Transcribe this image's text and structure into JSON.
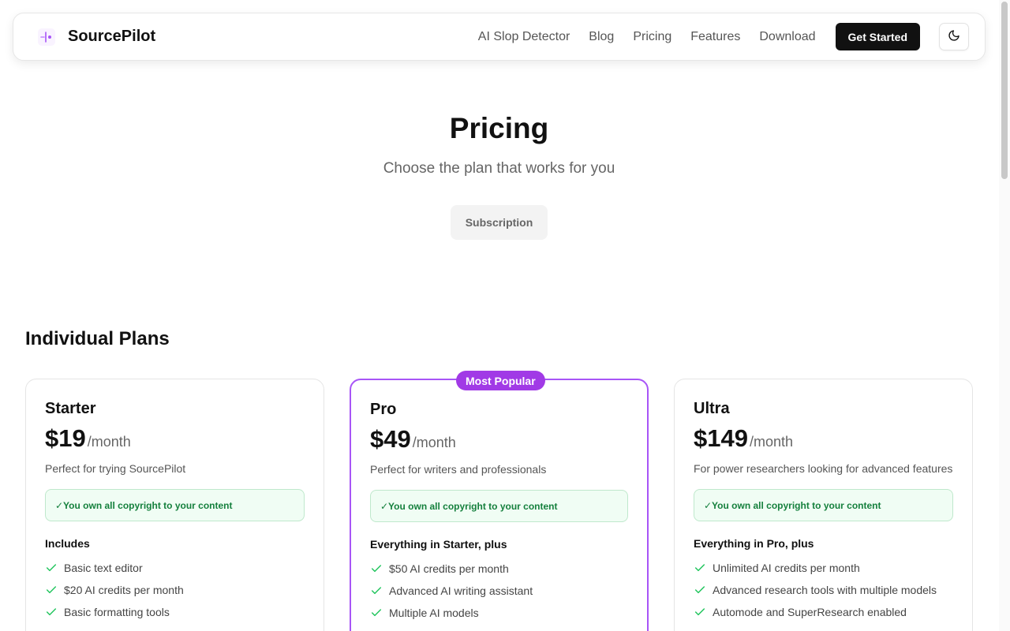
{
  "nav": {
    "brand": "SourcePilot",
    "links": [
      "AI Slop Detector",
      "Blog",
      "Pricing",
      "Features",
      "Download"
    ],
    "cta": "Get Started",
    "theme_icon": "moon-icon"
  },
  "hero": {
    "title": "Pricing",
    "subtitle": "Choose the plan that works for you",
    "tab": "Subscription"
  },
  "section_title": "Individual Plans",
  "colors": {
    "accent": "#a855f7",
    "badge": "#a13ae6",
    "check": "#22c55e",
    "copyright_text": "#15803d"
  },
  "plans": [
    {
      "name": "Starter",
      "price": "$19",
      "period": "/month",
      "description": "Perfect for trying SourcePilot",
      "copyright": "✓You own all copyright to your content",
      "includes": "Includes",
      "features": [
        "Basic text editor",
        "$20 AI credits per month",
        "Basic formatting tools"
      ]
    },
    {
      "name": "Pro",
      "badge": "Most Popular",
      "price": "$49",
      "period": "/month",
      "description": "Perfect for writers and professionals",
      "copyright": "✓You own all copyright to your content",
      "includes": "Everything in Starter, plus",
      "features": [
        "$50 AI credits per month",
        "Advanced AI writing assistant",
        "Multiple AI models"
      ]
    },
    {
      "name": "Ultra",
      "price": "$149",
      "period": "/month",
      "description": "For power researchers looking for advanced features",
      "copyright": "✓You own all copyright to your content",
      "includes": "Everything in Pro, plus",
      "features": [
        "Unlimited AI credits per month",
        "Advanced research tools with multiple models",
        "Automode and SuperResearch enabled"
      ]
    }
  ]
}
